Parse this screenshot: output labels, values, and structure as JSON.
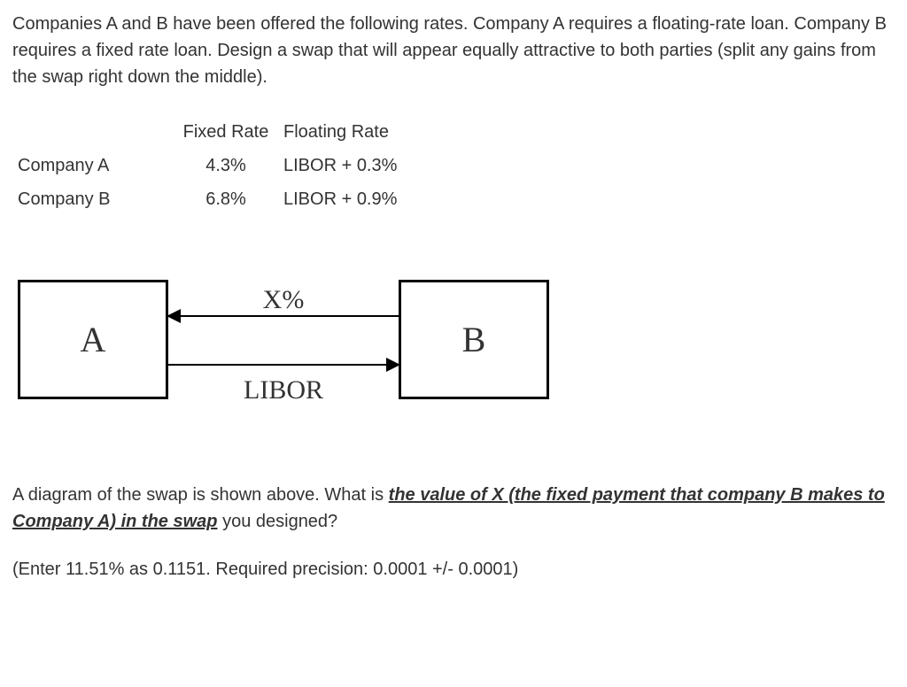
{
  "intro": "Companies A and B have been offered the following rates. Company A requires a floating-rate loan. Company B requires a fixed rate loan. Design a swap that will appear equally attractive to both parties (split any gains from the swap right down the middle).",
  "table": {
    "headers": [
      "",
      "Fixed Rate",
      "Floating Rate"
    ],
    "rows": [
      {
        "company": "Company A",
        "fixed": "4.3%",
        "floating": "LIBOR + 0.3%"
      },
      {
        "company": "Company B",
        "fixed": "6.8%",
        "floating": "LIBOR + 0.9%"
      }
    ]
  },
  "diagram": {
    "box_a": "A",
    "box_b": "B",
    "label_top": "X%",
    "label_bottom": "LIBOR"
  },
  "question": {
    "pre": "A diagram of the swap is shown above. What is ",
    "emphasis": "the value of X (the fixed payment that company B makes to Company A) in the swap",
    "post": " you designed?"
  },
  "precision": "(Enter 11.51% as 0.1151. Required precision: 0.0001 +/- 0.0001)"
}
